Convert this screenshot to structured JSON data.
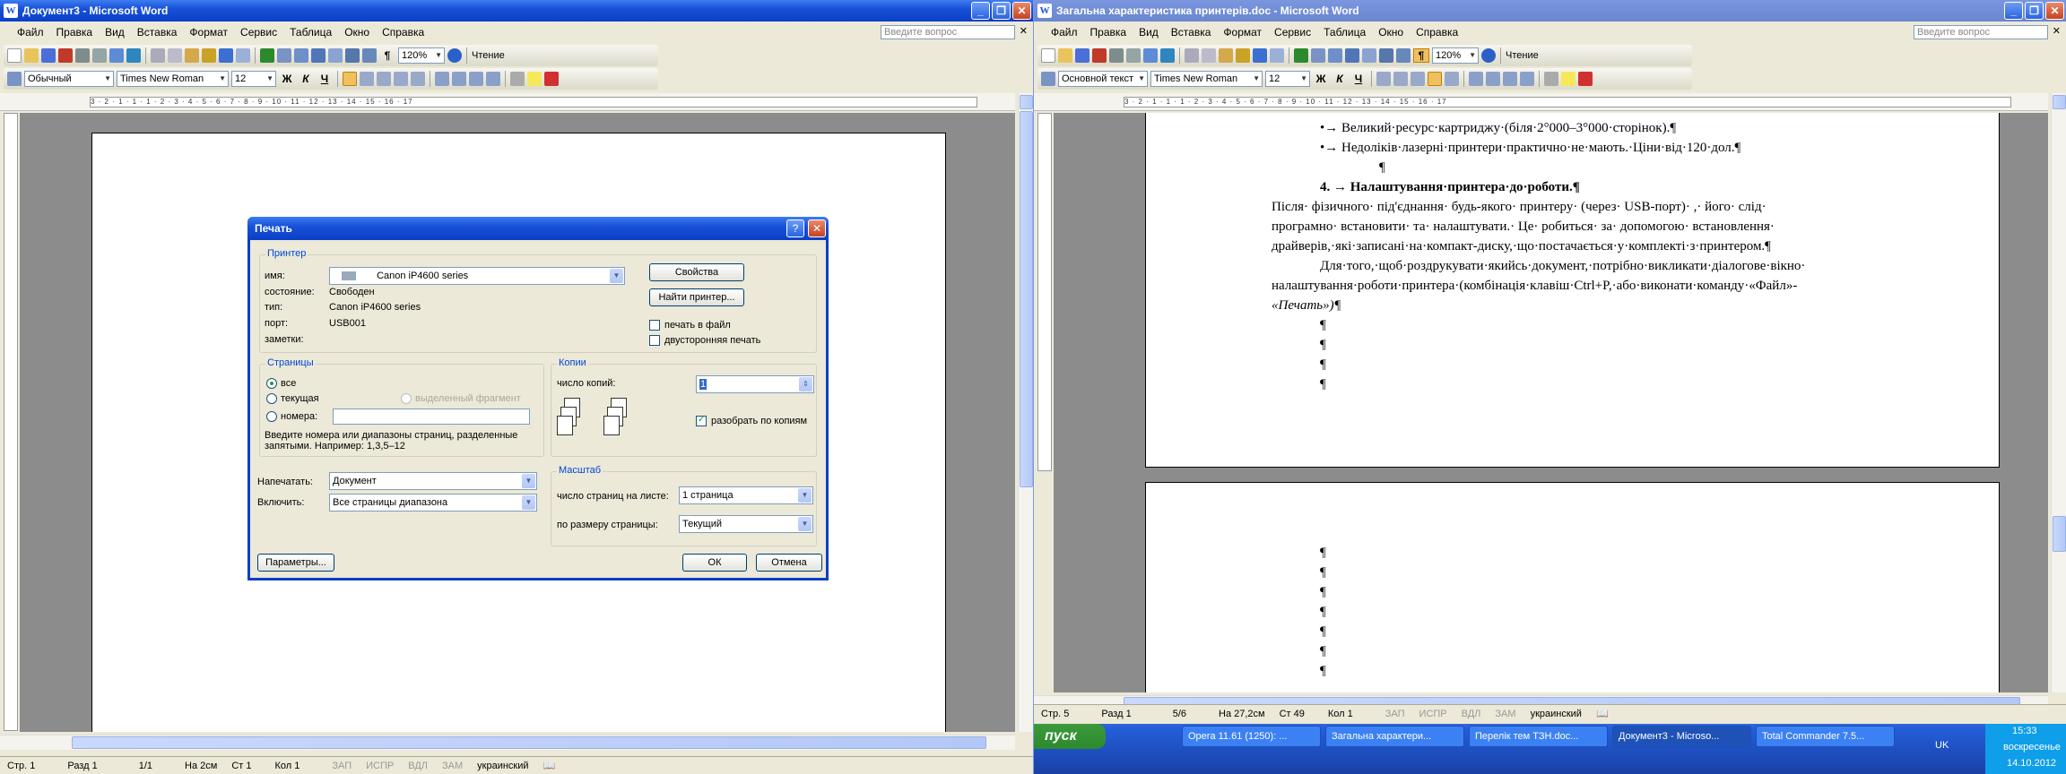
{
  "left": {
    "title": "Документ3 - Microsoft Word",
    "menu": [
      "Файл",
      "Правка",
      "Вид",
      "Вставка",
      "Формат",
      "Сервис",
      "Таблица",
      "Окно",
      "Справка"
    ],
    "question_placeholder": "Введите вопрос",
    "zoom": "120%",
    "read_label": "Чтение",
    "style": "Обычный",
    "font": "Times New Roman",
    "size": "12",
    "ruler_text": "3 · 2 · 1 · 1 · 1 · 2 · 3 · 4 · 5 · 6 · 7 · 8 · 9 · 10 · 11 · 12 · 13 · 14 · 15 · 16 · 17",
    "status": {
      "page": "Стр. 1",
      "section": "Разд 1",
      "pages": "1/1",
      "at": "На 2см",
      "line": "Ст 1",
      "col": "Кол 1",
      "rec": "ЗАП",
      "trk": "ИСПР",
      "ext": "ВДЛ",
      "ovr": "ЗАМ",
      "lang": "украинский"
    }
  },
  "dialog": {
    "title": "Печать",
    "printer_group": "Принтер",
    "name_label": "имя:",
    "printer_name": "Canon iP4600 series",
    "properties_btn": "Свойства",
    "find_btn": "Найти принтер...",
    "state_label": "состояние:",
    "state_value": "Свободен",
    "type_label": "тип:",
    "type_value": "Canon iP4600 series",
    "port_label": "порт:",
    "port_value": "USB001",
    "notes_label": "заметки:",
    "print_to_file": "печать в файл",
    "duplex": "двусторонняя печать",
    "pages_group": "Страницы",
    "all": "все",
    "current": "текущая",
    "selection": "выделенный фрагмент",
    "numbers": "номера:",
    "hint": "Введите номера или диапазоны страниц, разделенные запятыми. Например: 1,3,5–12",
    "copies_group": "Копии",
    "copies_label": "число копий:",
    "copies_value": "1",
    "collate": "разобрать по копиям",
    "print_label": "Напечатать:",
    "print_value": "Документ",
    "include_label": "Включить:",
    "include_value": "Все страницы диапазона",
    "scale_group": "Масштаб",
    "pps_label": "число страниц на листе:",
    "pps_value": "1 страница",
    "fit_label": "по размеру страницы:",
    "fit_value": "Текущий",
    "options_btn": "Параметры...",
    "ok_btn": "ОК",
    "cancel_btn": "Отмена"
  },
  "right": {
    "title": "Загальна характеристика принтерів.doc - Microsoft Word",
    "menu": [
      "Файл",
      "Правка",
      "Вид",
      "Вставка",
      "Формат",
      "Сервис",
      "Таблица",
      "Окно",
      "Справка"
    ],
    "question_placeholder": "Введите вопрос",
    "zoom": "120%",
    "read_label": "Чтение",
    "style": "Основной текст",
    "font": "Times New Roman",
    "size": "12",
    "ruler_text": "3 · 2 · 1 · 1 · 1 · 2 · 3 · 4 · 5 · 6 · 7 · 8 · 9 · 10 · 11 · 12 · 13 · 14 · 15 · 16 · 17",
    "lines": [
      "•→ Великий·ресурс·картриджу·(біля·2°000–3°000·сторінок).¶",
      "•→ Недоліків·лазерні·принтери·практично·не·мають.·Ціни·від·120·дол.¶",
      "¶",
      "4.  →   Налаштування·принтера·до·роботи.¶",
      "Після· фізичного· під'єднання· будь-якого· принтеру· (через· USB-порт)· ,· його· слід·",
      "програмно·  встановити·  та·  налаштувати.·  Це·  робиться·  за·  допомогою·  встановлення·",
      "драйверів,·які·записані·на·компакт-диску,·що·постачається·у·комплекті·з·принтером.¶",
      "Для·того,·щоб·роздрукувати·якийсь·документ,·потрібно·викликати·діалогове·вікно·",
      "налаштування·роботи·принтера·(комбінація·клавіш·Ctrl+P,·або·виконати·команду·«Файл»-",
      "«Печать»)¶"
    ],
    "pilcrow": "¶",
    "status": {
      "page": "Стр. 5",
      "section": "Разд 1",
      "pages": "5/6",
      "at": "На 27,2см",
      "line": "Ст 49",
      "col": "Кол 1",
      "rec": "ЗАП",
      "trk": "ИСПР",
      "ext": "ВДЛ",
      "ovr": "ЗАМ",
      "lang": "украинский"
    }
  },
  "taskbar": {
    "start": "пуск",
    "tasks": [
      "Opera 11.61 (1250): ...",
      "Загальна характери...",
      "Перелік тем ТЗН.doc...",
      "Документ3 - Microso...",
      "Total Commander 7.5..."
    ],
    "lang": "UK",
    "time": "15:33",
    "day": "воскресенье",
    "date": "14.10.2012"
  }
}
